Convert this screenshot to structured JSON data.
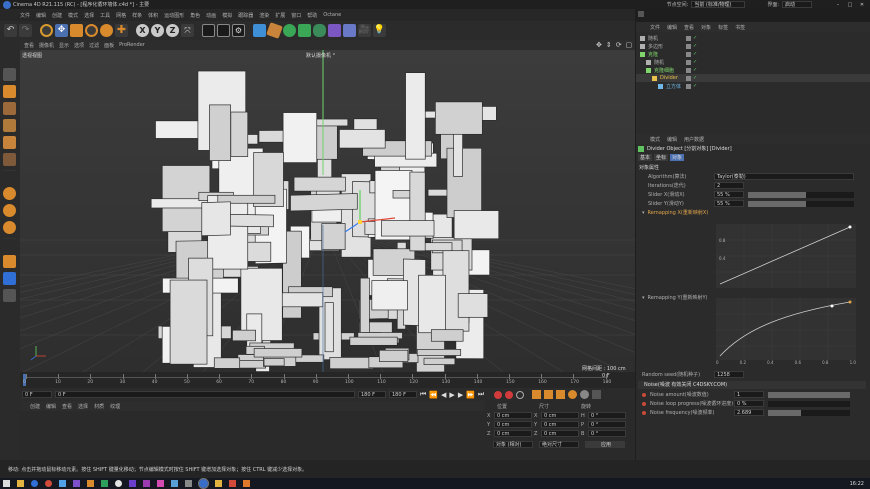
{
  "app": {
    "title": "Cinema 4D R21.115 (RC) - [程序化循环墙体.c4d *] - 主要",
    "node_space_label": "节点空间:",
    "node_space_value": "当前 (标准/物理)",
    "interface_label": "界面:",
    "interface_value": "启动"
  },
  "menu": [
    "文件",
    "编辑",
    "创建",
    "模式",
    "选择",
    "工具",
    "网格",
    "样条",
    "体积",
    "运动图形",
    "角色",
    "动画",
    "模拟",
    "跟踪器",
    "渲染",
    "扩展",
    "窗口",
    "帮助",
    "Octane"
  ],
  "viewport": {
    "menu": [
      "查看",
      "摄像机",
      "显示",
      "选项",
      "过滤",
      "面板",
      "ProRender"
    ],
    "label": "透视视图",
    "camera": "默认摄像机 °",
    "grid_spacing": "网格间距 : 100 cm"
  },
  "timeline": {
    "ticks": [
      "0",
      "10",
      "20",
      "30",
      "40",
      "50",
      "60",
      "70",
      "80",
      "90",
      "100",
      "110",
      "120",
      "130",
      "140",
      "150",
      "160",
      "170",
      "180"
    ],
    "frame_readout": "0 F"
  },
  "transport": {
    "start": "0 F",
    "current": "0 F",
    "end": "180 F",
    "end2": "180 F"
  },
  "material_panel": {
    "menu": [
      "创建",
      "编辑",
      "查看",
      "选择",
      "材质",
      "纹理"
    ]
  },
  "coords": {
    "headers": [
      "位置",
      "尺寸",
      "旋转"
    ],
    "rows": [
      {
        "axis": "X",
        "pos": "0 cm",
        "size_axis": "X",
        "size": "0 cm",
        "rot_axis": "H",
        "rot": "0 °"
      },
      {
        "axis": "Y",
        "pos": "0 cm",
        "size_axis": "Y",
        "size": "0 cm",
        "rot_axis": "P",
        "rot": "0 °"
      },
      {
        "axis": "Z",
        "pos": "0 cm",
        "size_axis": "Z",
        "size": "0 cm",
        "rot_axis": "B",
        "rot": "0 °"
      }
    ],
    "mode1": "对象 (相对)",
    "mode2": "绝对尺寸",
    "apply": "应用"
  },
  "object_manager": {
    "menu": [
      "文件",
      "编辑",
      "查看",
      "对象",
      "标签",
      "书签"
    ],
    "items": [
      {
        "name": "随机",
        "indent": 0,
        "color": "#b0b0b0"
      },
      {
        "name": "多边形",
        "indent": 0,
        "color": "#b0b0b0"
      },
      {
        "name": "克隆",
        "indent": 0,
        "color": "#7fd46b"
      },
      {
        "name": "随机",
        "indent": 1,
        "color": "#b0b0b0"
      },
      {
        "name": "克隆细胞",
        "indent": 1,
        "color": "#7fd46b"
      },
      {
        "name": "Divider",
        "indent": 2,
        "color": "#e8c24a"
      },
      {
        "name": "立方体",
        "indent": 3,
        "color": "#6fb8e8"
      }
    ]
  },
  "attr_manager": {
    "menu": [
      "模式",
      "编辑",
      "用户数据"
    ],
    "title": "Divider Object [分割对象] [Divider]",
    "tabs": [
      "基本",
      "坐标",
      "对象"
    ],
    "section": "对象属性",
    "fields": [
      {
        "label": "Algorithm(算法)",
        "value": "Taylor(泰勒)"
      },
      {
        "label": "Iterations(迭代)",
        "value": "2"
      },
      {
        "label": "Slider X(滑动X)",
        "value": "55 %"
      },
      {
        "label": "Slider Y(滑动Y)",
        "value": "55 %"
      }
    ],
    "remap_x_label": "Remapping X(重新映射X)",
    "remap_y_label": "Remapping Y(重新映射Y)",
    "graph_labels": [
      "0.8",
      "0.4",
      "0",
      "0.2",
      "0.4",
      "0.6",
      "0.8",
      "1.0"
    ],
    "random_seed_label": "Random seed(随机种子)",
    "random_seed_value": "1258",
    "noise_section": "Noise(噪波 有效关闭 C4DSKY.COM)",
    "noise_fields": [
      {
        "label": "Noise amount(噪波数值)",
        "value": "1"
      },
      {
        "label": "Noise loop progress(噪波循环进度)",
        "value": "0 %"
      },
      {
        "label": "Noise frequency(噪波频率)",
        "value": "2.689"
      }
    ]
  },
  "status": "移动: 点击并拖动鼠标移动元素。按住 SHIFT 键量化移动；节点编辑模式时按住 SHIFT 键增加选择对象；按住 CTRL 键减少选择对象。",
  "taskbar": {
    "clock": "16:22"
  }
}
